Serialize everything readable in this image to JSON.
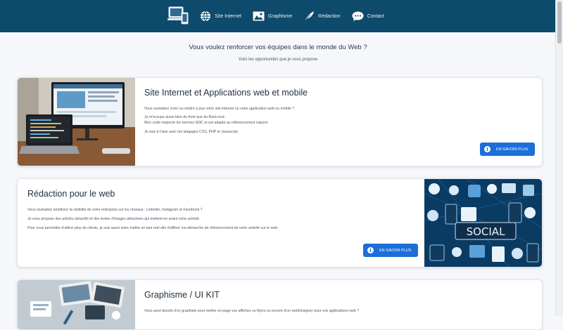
{
  "nav": {
    "items": [
      {
        "label": "Site Internet",
        "icon": "globe-icon"
      },
      {
        "label": "Graphisme",
        "icon": "image-icon"
      },
      {
        "label": "Rédaction",
        "icon": "feather-icon"
      },
      {
        "label": "Contact",
        "icon": "chat-icon"
      }
    ]
  },
  "intro": {
    "title": "Vous voulez renforcer vos équipes dans le monde du Web ?",
    "subtitle": "Voici les opportunités que je vous propose"
  },
  "cards": [
    {
      "title": "Site Internet et Applications web et mobile",
      "lines": [
        "Vous souhaitez créer ou mettre à jour votre site internet ou votre application web ou mobile ?",
        "Je m'occupe aussi bien du front que du Back-end.",
        "Mon code respecte les normes W3C et est adapté au référencement naturel.",
        "Je suis à l'aise avec les langages CSS, PHP et Javascript."
      ],
      "button": "EN SAVOIR PLUS"
    },
    {
      "title": "Rédaction pour le web",
      "lines": [
        "Vous souhaitez améliorer la visibilité de votre entreprise sur les réseaux : Linkedin, Instagram et Facebook ?",
        "Je vous propose des articles attractifs et des textes d'images attractives qui mettent en avant votre activité.",
        "Pour vous permettre d'attirer plus de clients, je suis aussi votre maître en tant réel afin d'affiner ma démarche de référencement de votre activité sur le web."
      ],
      "button": "EN SAVOIR PLUS",
      "image_caption": "SOCIAL"
    },
    {
      "title": "Graphisme / UI KIT",
      "lines": [
        "Vous avez besoin d'un graphiste pour mettre en page vos affiches ou flyers ou encore d'un webDesigner pour vos applications web ?"
      ]
    }
  ]
}
